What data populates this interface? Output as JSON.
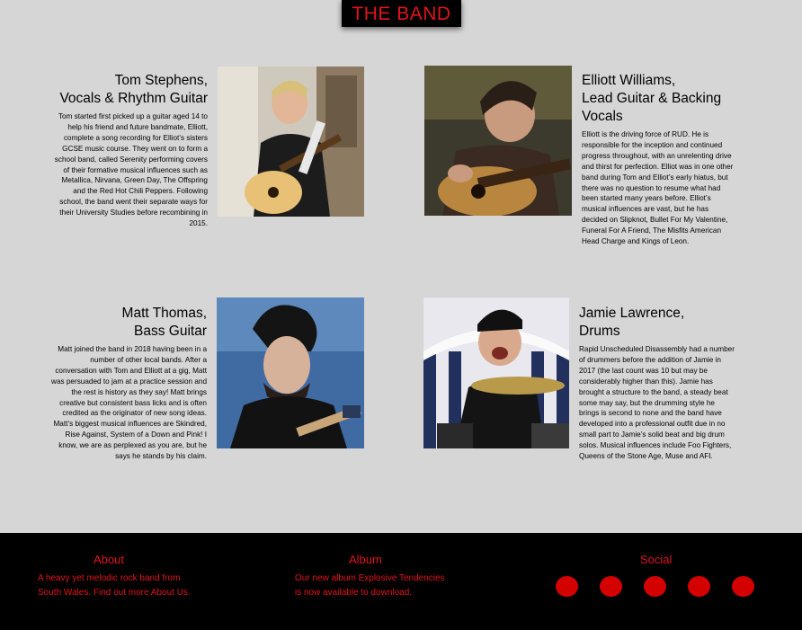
{
  "header": {
    "title": "THE BAND"
  },
  "members": [
    {
      "name_line1": "Tom Stephens,",
      "name_line2": "Vocals & Rhythm Guitar",
      "bio": "Tom started first picked up a guitar aged 14 to help his friend and future bandmate, Elliott, complete a song recording for Elliot’s sisters GCSE music course. They went on to form a school band, called Serenity performing covers of their formative musical influences such as Metallica, Nirvana, Green Day, The Offspring and the Red Hot Chili Peppers. Following school, the band went their separate ways for their University Studies before recombining in 2015."
    },
    {
      "name_line1": "Elliott Williams,",
      "name_line2": "Lead Guitar & Backing Vocals",
      "bio": "Elliott is the driving force of RUD. He is responsible for the inception and continued progress throughout, with an unrelenting drive and thirst for perfection. Elliot was in one other band during Tom and Elliot’s early hiatus, but there was no question to resume what had been started many years before. Elliot’s musical influences are vast, but he has decided on Slipknot, Bullet For My Valentine, Funeral For A Friend, The Misfits American Head Charge and Kings of Leon."
    },
    {
      "name_line1": "Matt Thomas,",
      "name_line2": "Bass Guitar",
      "bio": "Matt joined the band in 2018 having been in a number of other local bands. After a conversation with Tom and Elliott at a gig, Matt was persuaded to jam at a practice session and the rest is history as they say! Matt brings creative but consistent bass licks and is often credited as the originator of new song ideas. Matt’s biggest musical influences are Skindred, Rise Against, System of a Down and Pink! I know, we are as perplexed as you are, but he says he stands by his claim."
    },
    {
      "name_line1": "Jamie Lawrence,",
      "name_line2": "Drums",
      "bio": "Rapid Unscheduled Disassembly had a number of drummers before the addition of Jamie in 2017 (the last count was 10 but may be considerably higher than this). Jamie has brought a structure to the band, a steady beat some may say, but the drumming style he brings is second to none and the band have developed into a professional outfit due in no small part to Jamie’s solid beat and big drum solos. Musical influences include Foo Fighters, Queens of the Stone Age, Muse and AFI."
    }
  ],
  "footer": {
    "about": {
      "heading": "About",
      "text_line1": "A heavy yet melodic rock band from",
      "text_line2": "South Wales.  Find out more About Us."
    },
    "album": {
      "heading": "Album",
      "text_line1": "Our new album Explosive Tendencies",
      "text_line2": "is now available to download."
    },
    "social": {
      "heading": "Social"
    }
  },
  "colors": {
    "accent": "#e0151b",
    "page_bg": "#d6d6d6",
    "footer_bg": "#000000",
    "social_dot": "#d40000"
  }
}
